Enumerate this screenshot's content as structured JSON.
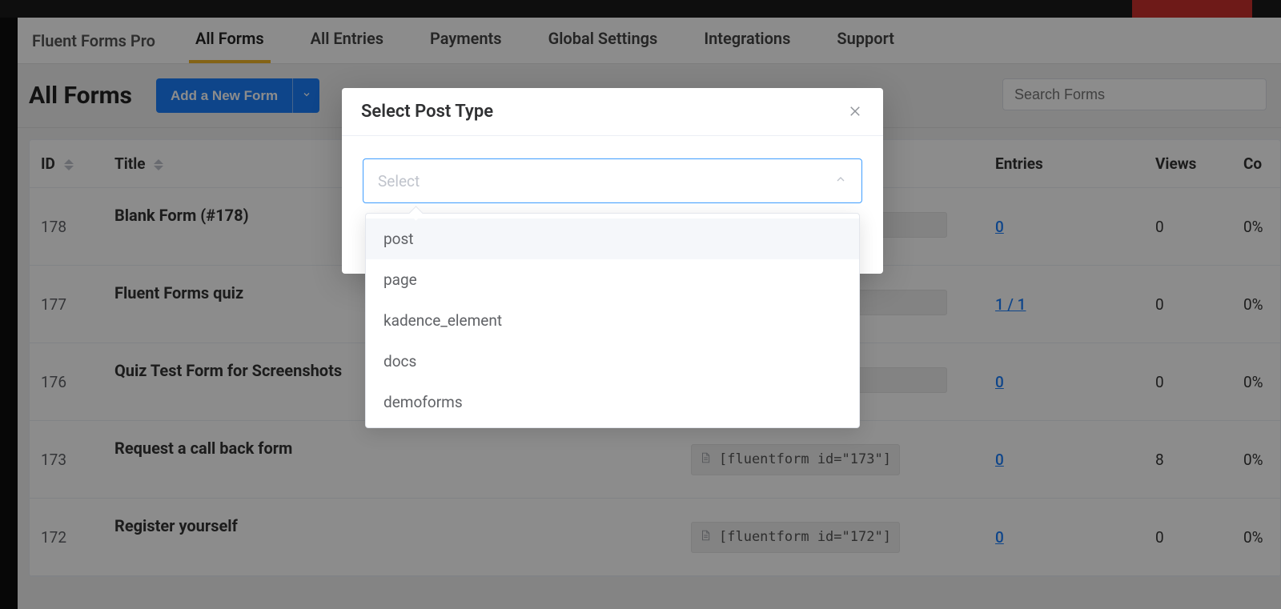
{
  "brand": "Fluent Forms Pro",
  "nav": {
    "tabs": [
      {
        "label": "All Forms",
        "active": true
      },
      {
        "label": "All Entries"
      },
      {
        "label": "Payments"
      },
      {
        "label": "Global Settings"
      },
      {
        "label": "Integrations"
      },
      {
        "label": "Support"
      }
    ]
  },
  "page": {
    "title": "All Forms",
    "add_button": "Add a New Form",
    "search_placeholder": "Search Forms"
  },
  "table": {
    "columns": {
      "id": "ID",
      "title": "Title",
      "entries": "Entries",
      "views": "Views",
      "conv": "Co"
    },
    "rows": [
      {
        "id": "178",
        "title": "Blank Form (#178)",
        "shortcode": "",
        "entries": "0",
        "views": "0",
        "conv": "0%"
      },
      {
        "id": "177",
        "title": "Fluent Forms quiz",
        "shortcode": "",
        "entries": "1 / 1",
        "views": "0",
        "conv": "0%"
      },
      {
        "id": "176",
        "title": "Quiz Test Form for Screenshots",
        "shortcode": "",
        "entries": "0",
        "views": "0",
        "conv": "0%"
      },
      {
        "id": "173",
        "title": "Request a call back form",
        "shortcode": "[fluentform id=\"173\"]",
        "entries": "0",
        "views": "8",
        "conv": "0%"
      },
      {
        "id": "172",
        "title": "Register yourself",
        "shortcode": "[fluentform id=\"172\"]",
        "entries": "0",
        "views": "0",
        "conv": "0%"
      }
    ]
  },
  "modal": {
    "title": "Select Post Type",
    "select_placeholder": "Select",
    "options": [
      "post",
      "page",
      "kadence_element",
      "docs",
      "demoforms"
    ]
  }
}
